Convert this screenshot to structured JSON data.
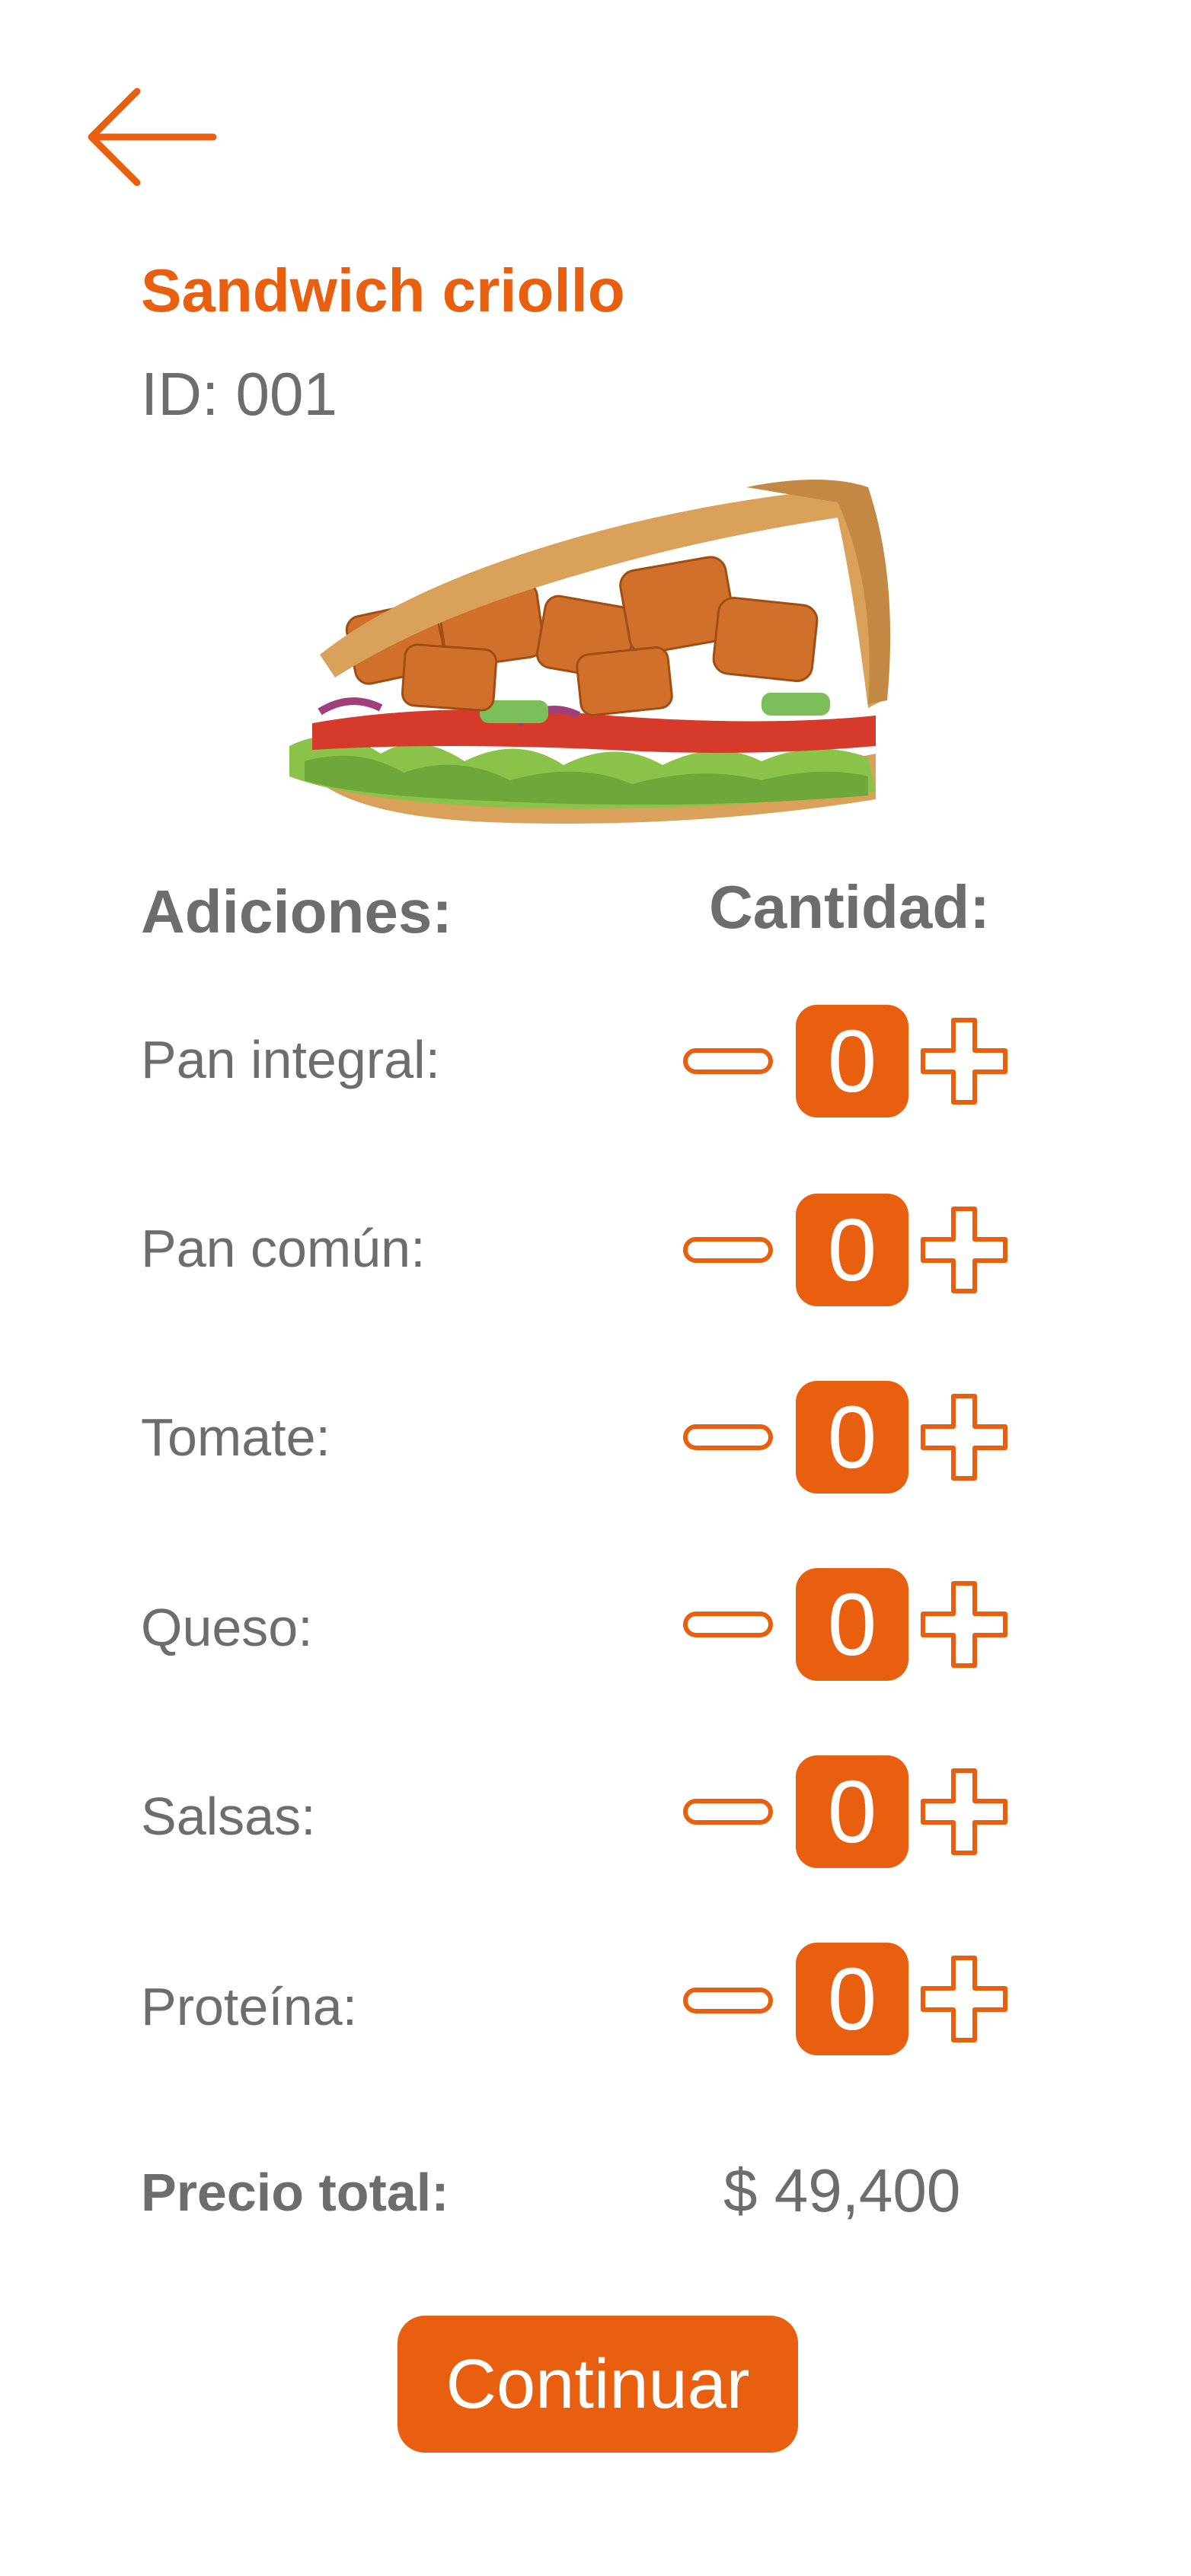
{
  "header": {
    "back_icon": "arrow-left-icon"
  },
  "product": {
    "name": "Sandwich criollo",
    "id_label": "ID: 001",
    "image_icon": "sandwich-image"
  },
  "section": {
    "additions_label": "Adiciones:",
    "quantity_label": "Cantidad:"
  },
  "additions": [
    {
      "label": "Pan integral:",
      "quantity": "0"
    },
    {
      "label": "Pan común:",
      "quantity": "0"
    },
    {
      "label": "Tomate:",
      "quantity": "0"
    },
    {
      "label": "Queso:",
      "quantity": "0"
    },
    {
      "label": "Salsas:",
      "quantity": "0"
    },
    {
      "label": "Proteína:",
      "quantity": "0"
    }
  ],
  "icons": {
    "decrement": "minus-icon",
    "increment": "plus-icon"
  },
  "total": {
    "label": "Precio total:",
    "value": "$ 49,400"
  },
  "actions": {
    "continue_label": "Continuar"
  },
  "colors": {
    "accent": "#E8600F",
    "text": "#6d6d6d",
    "background": "#ffffff"
  }
}
